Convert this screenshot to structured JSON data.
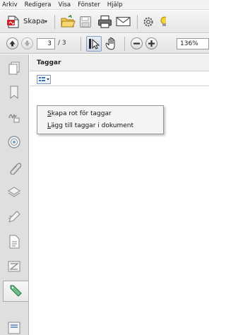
{
  "menu": [
    "Arkiv",
    "Redigera",
    "Visa",
    "Fönster",
    "Hjälp"
  ],
  "toolbar": {
    "create_label": "Skapa",
    "create_caret": "▾"
  },
  "navigation": {
    "page_current": "3",
    "page_total": "/ 3",
    "zoom": "136%"
  },
  "panel": {
    "title": "Taggar"
  },
  "context_menu": {
    "items": [
      {
        "label": "Skapa rot för taggar",
        "mnemonic": "S"
      },
      {
        "label": "Lägg till taggar i dokument",
        "mnemonic": "L"
      }
    ]
  },
  "colors": {
    "accent": "#2f7fcf",
    "rail_bg": "#dfdfdf",
    "tag_icon": "#3a9a5b"
  },
  "icons": {
    "create": "create-pdf-icon",
    "open": "open-folder-icon",
    "save": "save-disk-icon",
    "print": "printer-icon",
    "email": "email-envelope-icon",
    "settings": "gear-icon"
  }
}
